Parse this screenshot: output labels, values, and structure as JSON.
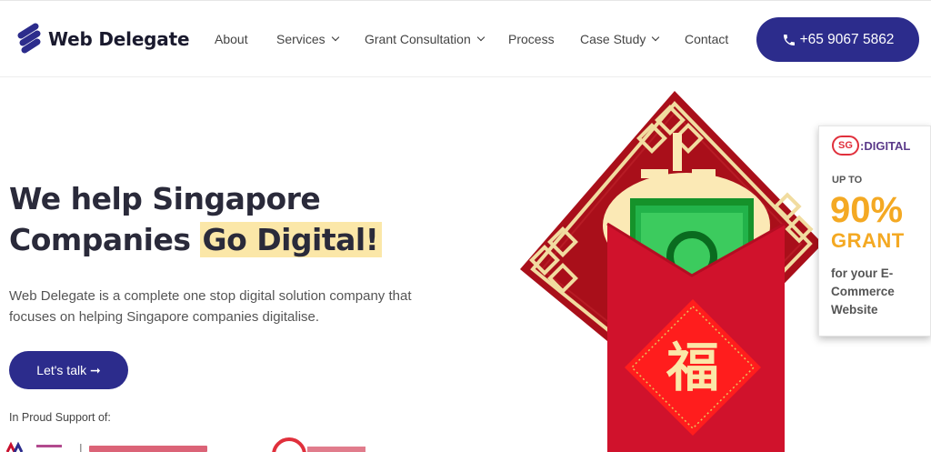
{
  "header": {
    "logo_text": "Web Delegate",
    "nav": [
      {
        "label": "About",
        "has_dropdown": false
      },
      {
        "label": "Services",
        "has_dropdown": true
      },
      {
        "label": "Grant Consultation",
        "has_dropdown": true
      },
      {
        "label": "Process",
        "has_dropdown": false
      },
      {
        "label": "Case Study",
        "has_dropdown": true
      },
      {
        "label": "Contact",
        "has_dropdown": false
      }
    ],
    "phone_label": "+65 9067 5862"
  },
  "hero": {
    "title_line1": "We help Singapore",
    "title_line2_prefix": "Companies ",
    "title_highlight": "Go Digital!",
    "subtitle": "Web Delegate is a complete one stop digital solution company that focuses on helping Singapore companies digitalise.",
    "cta_label": "Let's talk ➞",
    "support_label": "In Proud Support of:"
  },
  "grant_badge": {
    "logo_sg": "SG",
    "logo_digital": ":DIGITAL",
    "up_to": "UP TO",
    "percent": "90%",
    "grant": "GRANT",
    "desc": "for your E-Commerce Website"
  },
  "colors": {
    "brand_navy": "#2c2c8c",
    "highlight": "#fbe7a8",
    "envelope_red": "#d0122c",
    "grant_orange": "#f4a923"
  }
}
